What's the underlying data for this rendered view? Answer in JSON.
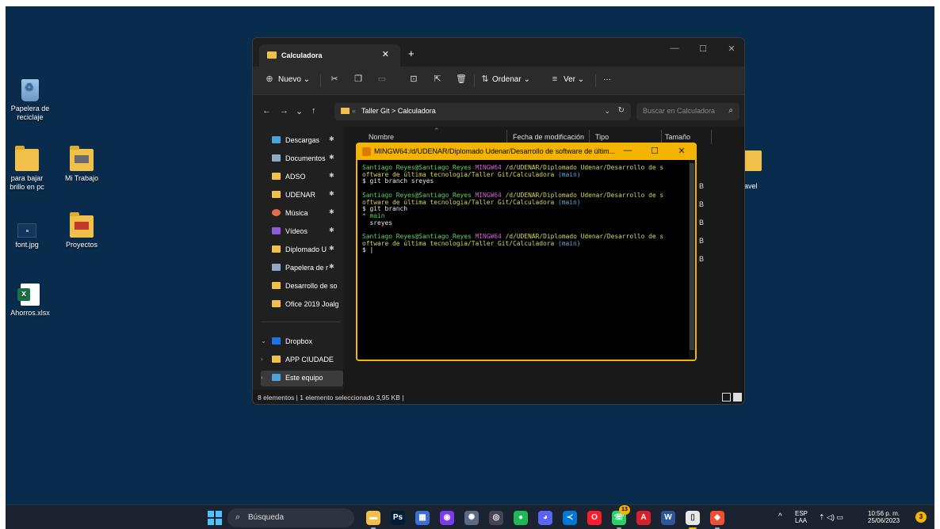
{
  "desktop": {
    "icons": [
      {
        "label": "Papelera de reciclaje"
      },
      {
        "label": "para bajar brillo en pc"
      },
      {
        "label": "Mi Trabajo"
      },
      {
        "label": "font.jpg"
      },
      {
        "label": "Proyectos"
      },
      {
        "label": "Ahorros.xlsx"
      }
    ],
    "behind_label": "ravel"
  },
  "explorer": {
    "tab_title": "Calculadora",
    "tab_close": "✕",
    "new_tab": "+",
    "window_buttons": [
      "—",
      "☐",
      "✕"
    ],
    "toolbar": {
      "new_label": "Nuevo",
      "sort_label": "Ordenar",
      "view_label": "Ver",
      "more": "···"
    },
    "address": {
      "breadcrumb": [
        "Taller Git",
        "Calculadora"
      ],
      "search_placeholder": "Buscar en Calculadora"
    },
    "nav": [
      {
        "label": "Descargas",
        "color": "#4aa3df",
        "pinned": true
      },
      {
        "label": "Documentos",
        "color": "#8fa9c8",
        "pinned": true
      },
      {
        "label": "ADSO",
        "color": "#f1c04b",
        "pinned": true
      },
      {
        "label": "UDENAR",
        "color": "#f1c04b",
        "pinned": true
      },
      {
        "label": "Música",
        "color": "#e46a4e",
        "pinned": true
      },
      {
        "label": "Vídeos",
        "color": "#8e5bd6",
        "pinned": true
      },
      {
        "label": "Diplomado U",
        "color": "#f1c04b",
        "pinned": true
      },
      {
        "label": "Papelera de r",
        "color": "#8fa9c8",
        "pinned": true
      },
      {
        "label": "Desarrollo de so",
        "color": "#f1c04b",
        "pinned": false
      },
      {
        "label": "Ofice 2019 Joalg",
        "color": "#f1c04b",
        "pinned": false
      }
    ],
    "nav_bottom": [
      {
        "label": "Dropbox",
        "color": "#1e73e8",
        "chevron": "⌄"
      },
      {
        "label": "APP CIUDADE",
        "color": "#f1c04b",
        "chevron": "›"
      },
      {
        "label": "Este equipo",
        "color": "#4aa3df",
        "chevron": "›"
      }
    ],
    "columns": [
      "Nombre",
      "Fecha de modificación",
      "Tipo",
      "Tamaño"
    ],
    "size_fragments": [
      "B",
      "B",
      "B",
      "B",
      "B"
    ],
    "status": "8 elementos  |  1 elemento seleccionado  3,95 KB  |"
  },
  "terminal": {
    "title": "MINGW64:/d/UDENAR/Diplomado Udenar/Desarrollo de software de últim...",
    "buttons": [
      "—",
      "☐",
      "✕"
    ],
    "blocks": [
      {
        "user": "Santiago Reyes@Santiago_Reyes",
        "env": "MINGW64",
        "path1": "/d/UDENAR/Diplomado Udenar/Desarrollo de s",
        "path2": "oftware de última tecnologia/Taller Git/Calculadora",
        "branch": "(main)",
        "command": "$ git branch sreyes",
        "output": []
      },
      {
        "user": "Santiago Reyes@Santiago_Reyes",
        "env": "MINGW64",
        "path1": "/d/UDENAR/Diplomado Udenar/Desarrollo de s",
        "path2": "oftware de última tecnologia/Taller Git/Calculadora",
        "branch": "(main)",
        "command": "$ git branch",
        "output_current": "* main",
        "output": [
          "  sreyes"
        ]
      },
      {
        "user": "Santiago Reyes@Santiago_Reyes",
        "env": "MINGW64",
        "path1": "/d/UDENAR/Diplomado Udenar/Desarrollo de s",
        "path2": "oftware de última tecnologia/Taller Git/Calculadora",
        "branch": "(main)",
        "command": "$ |",
        "output": []
      }
    ]
  },
  "taskbar": {
    "search_label": "Búsqueda",
    "apps": [
      {
        "name": "file-explorer",
        "glyph": "▬",
        "color": "#f1c04b"
      },
      {
        "name": "photoshop",
        "glyph": "Ps",
        "color": "#001e36"
      },
      {
        "name": "app-blue",
        "glyph": "▦",
        "color": "#3b6fd6"
      },
      {
        "name": "github",
        "glyph": "◉",
        "color": "#7c3aed"
      },
      {
        "name": "davinci",
        "glyph": "✺",
        "color": "#5b6b85"
      },
      {
        "name": "chrome-like",
        "glyph": "◎",
        "color": "#445"
      },
      {
        "name": "spotify",
        "glyph": "●",
        "color": "#1db954"
      },
      {
        "name": "discord",
        "glyph": "◕",
        "color": "#5865f2"
      },
      {
        "name": "vscode",
        "glyph": "≺",
        "color": "#0078d4"
      },
      {
        "name": "opera",
        "glyph": "O",
        "color": "#ff1b2d"
      },
      {
        "name": "whatsapp",
        "glyph": "☏",
        "color": "#25d366"
      },
      {
        "name": "acrobat",
        "glyph": "A",
        "color": "#d6212b"
      },
      {
        "name": "word",
        "glyph": "W",
        "color": "#2b579a"
      },
      {
        "name": "notepad",
        "glyph": "▯",
        "color": "#e8e8e8"
      },
      {
        "name": "git",
        "glyph": "◆",
        "color": "#f05032"
      }
    ],
    "whatsapp_badge": "13",
    "tray": {
      "chevron": "^",
      "lang": "ESP",
      "layout": "LAA",
      "icons": "⇡ ◁) ▭",
      "time": "10:56 p. m.",
      "date": "25/06/2023",
      "notif": "3"
    }
  }
}
